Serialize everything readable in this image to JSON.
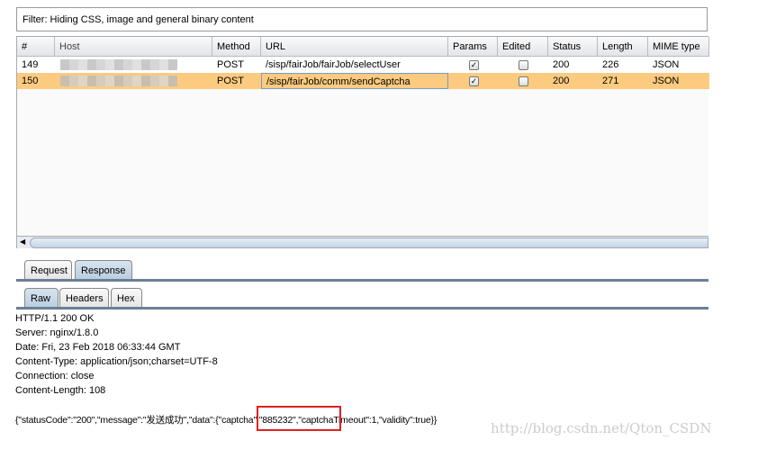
{
  "filter": {
    "text": "Filter:  Hiding CSS, image and general binary content"
  },
  "table": {
    "columns": [
      "#",
      "Host",
      "Method",
      "URL",
      "Params",
      "Edited",
      "Status",
      "Length",
      "MIME type"
    ],
    "rows": [
      {
        "num": "149",
        "method": "POST",
        "url": "/sisp/fairJob/fairJob/selectUser",
        "params": true,
        "edited": false,
        "status": "200",
        "length": "226",
        "mime": "JSON",
        "selected": false
      },
      {
        "num": "150",
        "method": "POST",
        "url": "/sisp/fairJob/comm/sendCaptcha",
        "params": true,
        "edited": false,
        "status": "200",
        "length": "271",
        "mime": "JSON",
        "selected": true
      }
    ]
  },
  "tabs": {
    "outer": [
      "Request",
      "Response"
    ],
    "inner": [
      "Raw",
      "Headers",
      "Hex"
    ]
  },
  "response": {
    "lines": [
      "HTTP/1.1 200 OK",
      "Server: nginx/1.8.0",
      "Date: Fri, 23 Feb 2018 06:33:44 GMT",
      "Content-Type: application/json;charset=UTF-8",
      "Connection: close",
      "Content-Length: 108"
    ],
    "body": "{\"statusCode\":\"200\",\"message\":\"发送成功\",\"data\":{\"captcha\":\"885232\",\"captchaTimeout\":1,\"validity\":true}}"
  },
  "watermark": "http://blog.csdn.net/Qton_CSDN",
  "colors": {
    "selected_row": "#fdcb80",
    "highlight": "#e02020"
  }
}
